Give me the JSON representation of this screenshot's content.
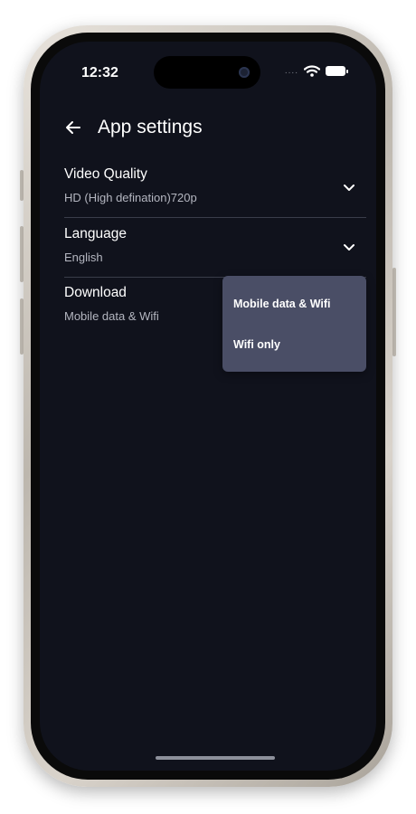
{
  "status_bar": {
    "time": "12:32",
    "signal_dots": "....",
    "icons": [
      "wifi-icon",
      "battery-icon"
    ]
  },
  "header": {
    "title": "App settings",
    "back_icon": "arrow-left-icon"
  },
  "settings": [
    {
      "title": "Video Quality",
      "value": "HD (High defination)720p",
      "icon": "chevron-down-icon"
    },
    {
      "title": "Language",
      "value": "English",
      "icon": "chevron-down-icon"
    },
    {
      "title": "Download",
      "value": "Mobile data & Wifi"
    }
  ],
  "download_dropdown": {
    "options": [
      "Mobile data & Wifi",
      "Wifi only"
    ]
  },
  "colors": {
    "screen_bg": "#10121c",
    "dropdown_bg": "#4a4e66",
    "divider": "#3a3d4a",
    "subtext": "#b4b6c0"
  }
}
